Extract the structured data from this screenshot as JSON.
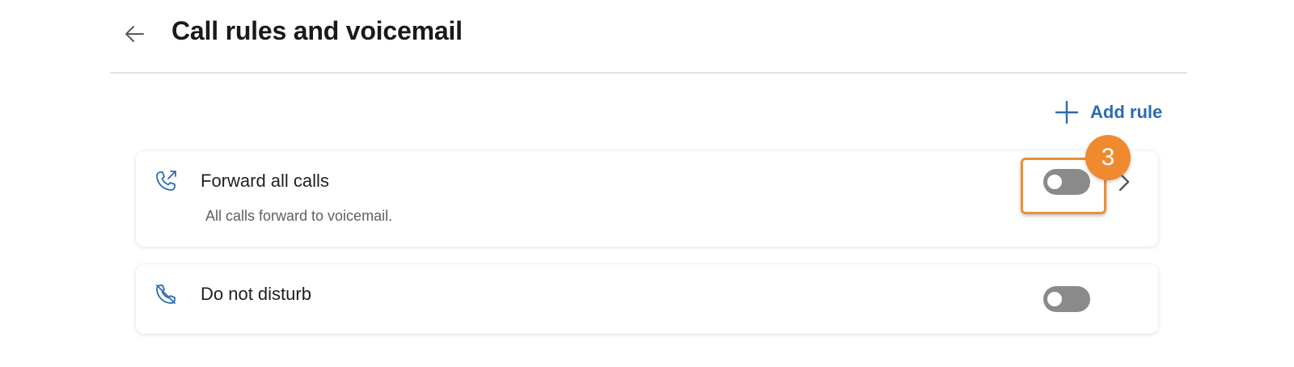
{
  "header": {
    "title": "Call rules and voicemail",
    "back_icon": "arrow-left-icon"
  },
  "actions": {
    "add_rule_label": "Add rule",
    "add_icon": "plus-icon"
  },
  "rules": [
    {
      "title": "Forward all calls",
      "description": "All calls forward to voicemail.",
      "icon": "phone-forward-icon",
      "enabled": false,
      "has_details": true
    },
    {
      "title": "Do not disturb",
      "icon": "phone-off-icon",
      "enabled": false
    }
  ],
  "annotation": {
    "step_number": "3",
    "color": "#ef8a2f"
  },
  "colors": {
    "accent": "#2b6cb0",
    "toggle_off": "#8a8a8a"
  }
}
